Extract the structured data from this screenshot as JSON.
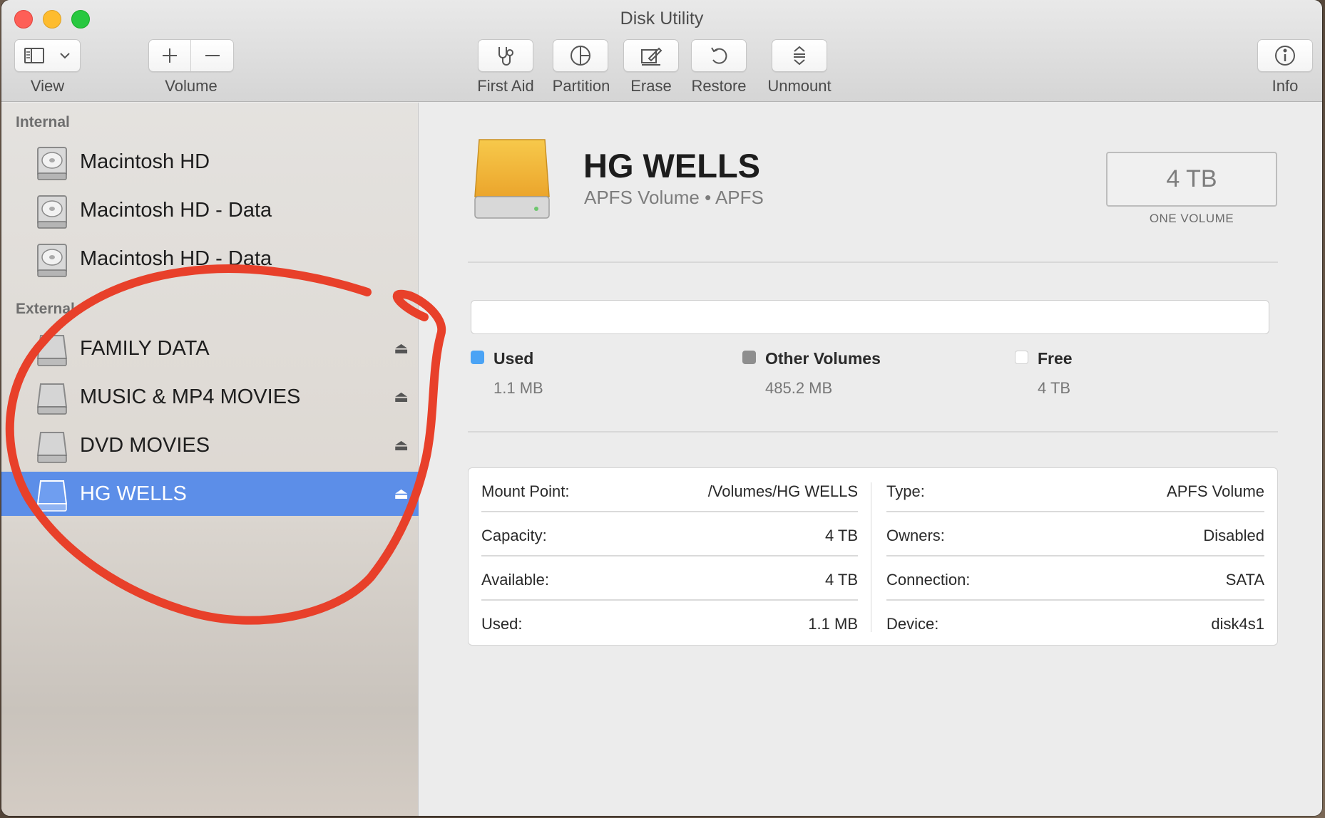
{
  "window": {
    "title": "Disk Utility"
  },
  "toolbar": {
    "view_label": "View",
    "volume_label": "Volume",
    "first_aid_label": "First Aid",
    "partition_label": "Partition",
    "erase_label": "Erase",
    "restore_label": "Restore",
    "unmount_label": "Unmount",
    "info_label": "Info"
  },
  "sidebar": {
    "internal_header": "Internal",
    "external_header": "External",
    "internal_items": [
      {
        "label": "Macintosh HD",
        "icon": "internal-disk-icon"
      },
      {
        "label": "Macintosh HD - Data",
        "icon": "internal-disk-icon"
      },
      {
        "label": "Macintosh HD - Data",
        "icon": "internal-disk-icon"
      }
    ],
    "external_items": [
      {
        "label": "FAMILY DATA",
        "icon": "external-disk-icon",
        "eject": "⏏"
      },
      {
        "label": "MUSIC & MP4 MOVIES",
        "icon": "external-disk-icon",
        "eject": "⏏"
      },
      {
        "label": "DVD MOVIES",
        "icon": "external-disk-icon",
        "eject": "⏏"
      },
      {
        "label": "HG WELLS",
        "icon": "external-disk-icon",
        "eject": "⏏",
        "selected": true
      }
    ]
  },
  "volume": {
    "name": "HG WELLS",
    "subtitle": "APFS Volume • APFS",
    "capacity": "4 TB",
    "capacity_caption": "ONE VOLUME",
    "used_fraction": 0
  },
  "legend": [
    {
      "name": "Used",
      "value": "1.1 MB",
      "color": "#4aa3f5"
    },
    {
      "name": "Other Volumes",
      "value": "485.2 MB",
      "color": "#8e8e8e"
    },
    {
      "name": "Free",
      "value": "4 TB",
      "color": "#ffffff"
    }
  ],
  "info": {
    "left": [
      {
        "key": "Mount Point:",
        "value": "/Volumes/HG WELLS"
      },
      {
        "key": "Capacity:",
        "value": "4 TB"
      },
      {
        "key": "Available:",
        "value": "4 TB"
      },
      {
        "key": "Used:",
        "value": "1.1 MB"
      }
    ],
    "right": [
      {
        "key": "Type:",
        "value": "APFS Volume"
      },
      {
        "key": "Owners:",
        "value": "Disabled"
      },
      {
        "key": "Connection:",
        "value": "SATA"
      },
      {
        "key": "Device:",
        "value": "disk4s1"
      }
    ]
  },
  "colors": {
    "selection": "#5c8ee8",
    "annotation": "#e8402a",
    "volume_icon": "#f1b43a"
  }
}
